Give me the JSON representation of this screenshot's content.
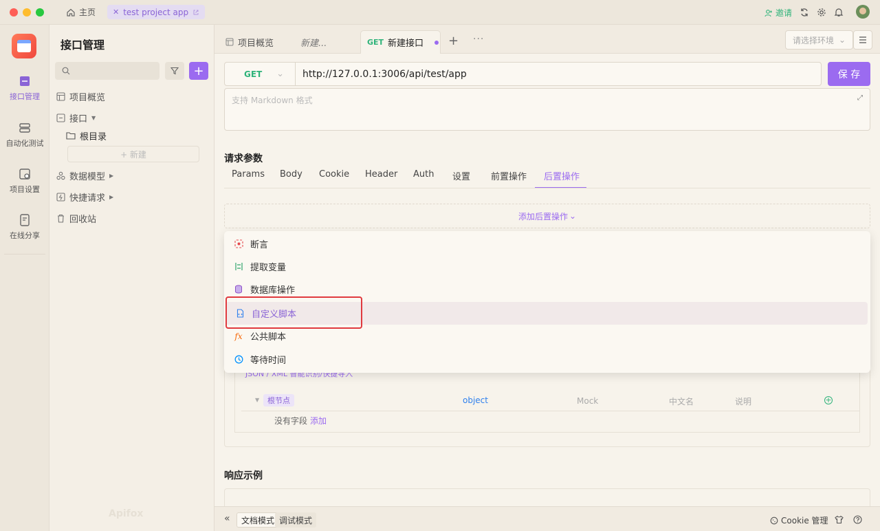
{
  "titlebar": {
    "home_label": "主页",
    "project_tab": "test project app",
    "invite_label": "邀请"
  },
  "rail": {
    "items": [
      {
        "label": "接口管理",
        "active": true
      },
      {
        "label": "自动化测试",
        "active": false
      },
      {
        "label": "项目设置",
        "active": false
      },
      {
        "label": "在线分享",
        "active": false
      }
    ]
  },
  "sidebar": {
    "title": "接口管理",
    "search_placeholder": "",
    "tree": {
      "overview": "项目概览",
      "interfaces": "接口",
      "root_dir": "根目录",
      "new_button": "+ 新建",
      "data_models": "数据模型",
      "quick_requests": "快捷请求",
      "recycle_bin": "回收站"
    },
    "watermark": "Apifox"
  },
  "tabs": {
    "items": [
      {
        "label": "项目概览"
      },
      {
        "label": "新建..."
      },
      {
        "method": "GET",
        "label": "新建接口"
      }
    ],
    "env_placeholder": "请选择环境"
  },
  "request": {
    "method": "GET",
    "url": "http://127.0.0.1:3006/api/test/app",
    "save_label": "保 存",
    "desc_placeholder": "支持 Markdown 格式"
  },
  "params": {
    "title": "请求参数",
    "tabs": [
      "Params",
      "Body",
      "Cookie",
      "Header",
      "Auth",
      "设置",
      "前置操作",
      "后置操作"
    ],
    "active_tab": "后置操作",
    "add_post_label": "添加后置操作"
  },
  "menu": {
    "items": [
      {
        "label": "断言",
        "icon": "assert-icon",
        "color": "#e5484d"
      },
      {
        "label": "提取变量",
        "icon": "extract-variable-icon",
        "color": "#30a46c"
      },
      {
        "label": "数据库操作",
        "icon": "database-icon",
        "color": "#8e4ec6"
      },
      {
        "label": "自定义脚本",
        "icon": "script-icon",
        "color": "#2f80ed"
      },
      {
        "label": "公共脚本",
        "icon": "fx-icon",
        "color": "#f76808"
      },
      {
        "label": "等待时间",
        "icon": "clock-icon",
        "color": "#0091ff"
      }
    ],
    "highlighted": "自定义脚本"
  },
  "schema": {
    "json_import": "JSON / XML 智能识别/快捷导入",
    "root_node": "根节点",
    "type": "object",
    "mock_placeholder": "Mock",
    "cn_name_placeholder": "中文名",
    "desc_placeholder": "说明",
    "no_fields": "没有字段",
    "add_link": "添加"
  },
  "response": {
    "title": "响应示例"
  },
  "bottom": {
    "doc_mode": "文档模式",
    "debug_mode": "调试模式",
    "cookie_label": "Cookie 管理"
  },
  "colors": {
    "accent": "#9b6bf0",
    "highlight_box": "#e0393e",
    "get_green": "#2fb37a"
  }
}
